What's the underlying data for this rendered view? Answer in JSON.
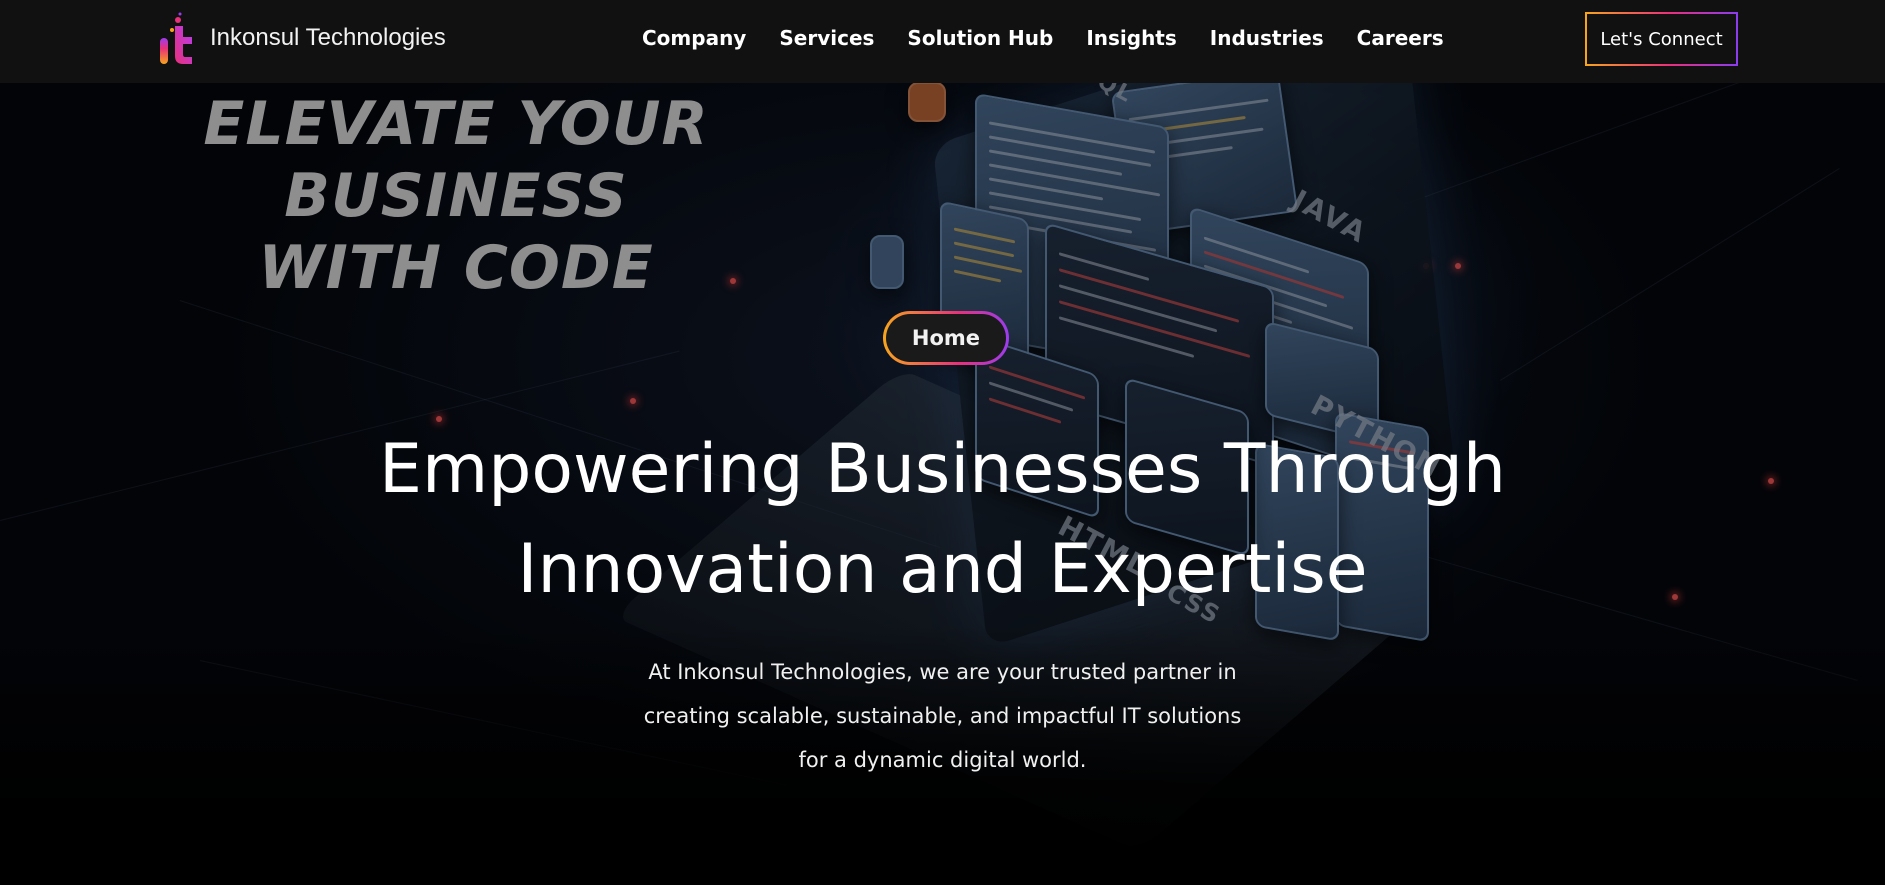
{
  "header": {
    "brand_name": "Inkonsul Technologies",
    "nav_items": [
      {
        "label": "Company"
      },
      {
        "label": "Services"
      },
      {
        "label": "Solution Hub"
      },
      {
        "label": "Insights"
      },
      {
        "label": "Industries"
      },
      {
        "label": "Careers"
      }
    ],
    "cta_label": "Let's Connect"
  },
  "hero": {
    "image_tagline_line1": "ELEVATE YOUR BUSINESS",
    "image_tagline_line2": "WITH CODE",
    "image_labels": [
      "JAVA",
      "PYTHON",
      "HTML",
      "CSS",
      "SQL"
    ],
    "breadcrumb_label": "Home",
    "headline_line1": "Empowering Businesses Through",
    "headline_line2": "Innovation and Expertise",
    "subtext_line1": "At Inkonsul Technologies, we are your trusted partner in",
    "subtext_line2": "creating scalable, sustainable, and impactful IT solutions",
    "subtext_line3": "for a dynamic digital world."
  },
  "colors": {
    "header_bg": "#111111",
    "gradient_start": "#f7a51d",
    "gradient_mid": "#e8317a",
    "gradient_end": "#8a3cf0"
  }
}
